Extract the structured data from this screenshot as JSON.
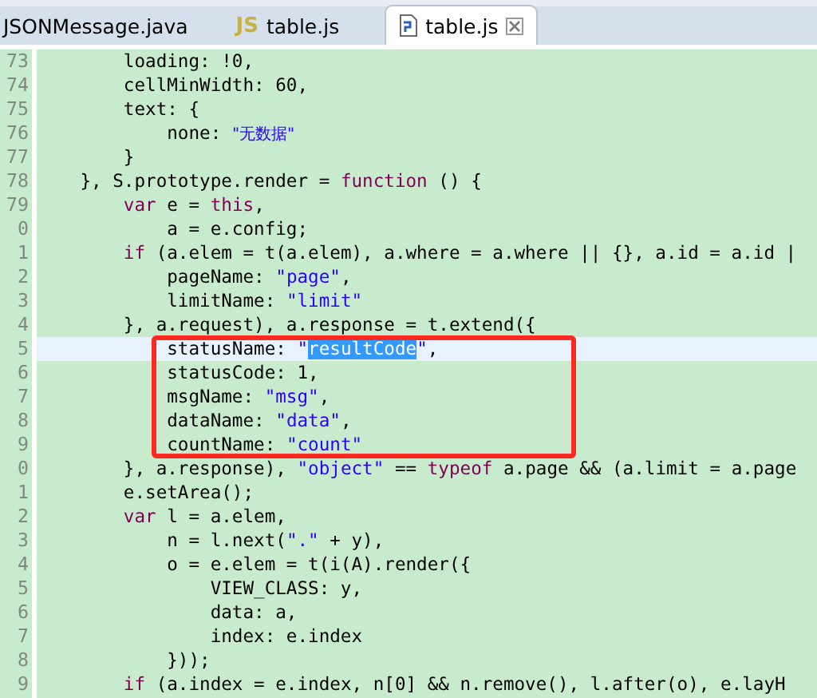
{
  "tabs": [
    {
      "label": "JSONMessage.java",
      "kind": "plain",
      "selected": false,
      "closable": false
    },
    {
      "label": "table.js",
      "kind": "js",
      "icon_text": "JS",
      "selected": false,
      "closable": false
    },
    {
      "label": "table.js",
      "kind": "file",
      "selected": true,
      "closable": true
    }
  ],
  "editor": {
    "lines": [
      {
        "number": "73",
        "current": false,
        "boxed": false,
        "tokens": [
          {
            "t": "        loading: !0,",
            "kind": "plain"
          }
        ]
      },
      {
        "number": "74",
        "current": false,
        "boxed": false,
        "tokens": [
          {
            "t": "        cellMinWidth: 60,",
            "kind": "plain"
          }
        ]
      },
      {
        "number": "75",
        "current": false,
        "boxed": false,
        "tokens": [
          {
            "t": "        text: {",
            "kind": "plain"
          }
        ]
      },
      {
        "number": "76",
        "current": false,
        "boxed": false,
        "tokens": [
          {
            "t": "            none: ",
            "kind": "plain"
          },
          {
            "t": "\"无数据\"",
            "kind": "cjk"
          }
        ]
      },
      {
        "number": "77",
        "current": false,
        "boxed": false,
        "tokens": [
          {
            "t": "        }",
            "kind": "plain"
          }
        ]
      },
      {
        "number": "78",
        "current": false,
        "boxed": false,
        "tokens": [
          {
            "t": "    }, S.prototype.render = ",
            "kind": "plain"
          },
          {
            "t": "function",
            "kind": "keyword"
          },
          {
            "t": " () {",
            "kind": "plain"
          }
        ]
      },
      {
        "number": "79",
        "current": false,
        "boxed": false,
        "tokens": [
          {
            "t": "        var",
            "kind": "keyword"
          },
          {
            "t": " e = ",
            "kind": "plain"
          },
          {
            "t": "this",
            "kind": "keyword"
          },
          {
            "t": ",",
            "kind": "plain"
          }
        ]
      },
      {
        "number": "0",
        "current": false,
        "boxed": false,
        "tokens": [
          {
            "t": "            a = e.config;",
            "kind": "plain"
          }
        ]
      },
      {
        "number": "1",
        "current": false,
        "boxed": false,
        "tokens": [
          {
            "t": "        if",
            "kind": "keyword"
          },
          {
            "t": " (a.elem = t(a.elem), a.where = a.where || {}, a.id = a.id |",
            "kind": "plain"
          }
        ]
      },
      {
        "number": "2",
        "current": false,
        "boxed": false,
        "tokens": [
          {
            "t": "            pageName: ",
            "kind": "plain"
          },
          {
            "t": "\"page\"",
            "kind": "string"
          },
          {
            "t": ",",
            "kind": "plain"
          }
        ]
      },
      {
        "number": "3",
        "current": false,
        "boxed": false,
        "tokens": [
          {
            "t": "            limitName: ",
            "kind": "plain"
          },
          {
            "t": "\"limit\"",
            "kind": "string"
          }
        ]
      },
      {
        "number": "4",
        "current": false,
        "boxed": false,
        "tokens": [
          {
            "t": "        }, a.request), a.response = t.extend({",
            "kind": "plain"
          }
        ]
      },
      {
        "number": "5",
        "current": true,
        "boxed": true,
        "tokens": [
          {
            "t": "            statusName: ",
            "kind": "plain"
          },
          {
            "t": "\"",
            "kind": "string"
          },
          {
            "t": "resultCode",
            "kind": "selection"
          },
          {
            "t": "\"",
            "kind": "string"
          },
          {
            "t": ",",
            "kind": "plain"
          }
        ]
      },
      {
        "number": "6",
        "current": false,
        "boxed": true,
        "tokens": [
          {
            "t": "            statusCode: 1,",
            "kind": "plain"
          }
        ]
      },
      {
        "number": "7",
        "current": false,
        "boxed": true,
        "tokens": [
          {
            "t": "            msgName: ",
            "kind": "plain"
          },
          {
            "t": "\"msg\"",
            "kind": "string"
          },
          {
            "t": ",",
            "kind": "plain"
          }
        ]
      },
      {
        "number": "8",
        "current": false,
        "boxed": true,
        "tokens": [
          {
            "t": "            dataName: ",
            "kind": "plain"
          },
          {
            "t": "\"data\"",
            "kind": "string"
          },
          {
            "t": ",",
            "kind": "plain"
          }
        ]
      },
      {
        "number": "9",
        "current": false,
        "boxed": true,
        "tokens": [
          {
            "t": "            countName: ",
            "kind": "plain"
          },
          {
            "t": "\"count\"",
            "kind": "string"
          }
        ]
      },
      {
        "number": "0",
        "current": false,
        "boxed": false,
        "tokens": [
          {
            "t": "        }, a.response), ",
            "kind": "plain"
          },
          {
            "t": "\"object\"",
            "kind": "string"
          },
          {
            "t": " == ",
            "kind": "plain"
          },
          {
            "t": "typeof",
            "kind": "keyword"
          },
          {
            "t": " a.page && (a.limit = a.page",
            "kind": "plain"
          }
        ]
      },
      {
        "number": "1",
        "current": false,
        "boxed": false,
        "tokens": [
          {
            "t": "        e.setArea();",
            "kind": "plain"
          }
        ]
      },
      {
        "number": "2",
        "current": false,
        "boxed": false,
        "tokens": [
          {
            "t": "        var",
            "kind": "keyword"
          },
          {
            "t": " l = a.elem,",
            "kind": "plain"
          }
        ]
      },
      {
        "number": "3",
        "current": false,
        "boxed": false,
        "tokens": [
          {
            "t": "            n = l.next(",
            "kind": "plain"
          },
          {
            "t": "\".\"",
            "kind": "string"
          },
          {
            "t": " + y),",
            "kind": "plain"
          }
        ]
      },
      {
        "number": "4",
        "current": false,
        "boxed": false,
        "tokens": [
          {
            "t": "            o = e.elem = t(i(A).render({",
            "kind": "plain"
          }
        ]
      },
      {
        "number": "5",
        "current": false,
        "boxed": false,
        "tokens": [
          {
            "t": "                VIEW_CLASS: y,",
            "kind": "plain"
          }
        ]
      },
      {
        "number": "6",
        "current": false,
        "boxed": false,
        "tokens": [
          {
            "t": "                data: a,",
            "kind": "plain"
          }
        ]
      },
      {
        "number": "7",
        "current": false,
        "boxed": false,
        "tokens": [
          {
            "t": "                index: e.index",
            "kind": "plain"
          }
        ]
      },
      {
        "number": "8",
        "current": false,
        "boxed": false,
        "tokens": [
          {
            "t": "            }));",
            "kind": "plain"
          }
        ]
      },
      {
        "number": "9",
        "current": false,
        "boxed": false,
        "tokens": [
          {
            "t": "        if",
            "kind": "keyword"
          },
          {
            "t": " (a.index = e.index, n[0] && n.remove(), l.after(o), e.layH",
            "kind": "plain"
          }
        ]
      }
    ]
  }
}
